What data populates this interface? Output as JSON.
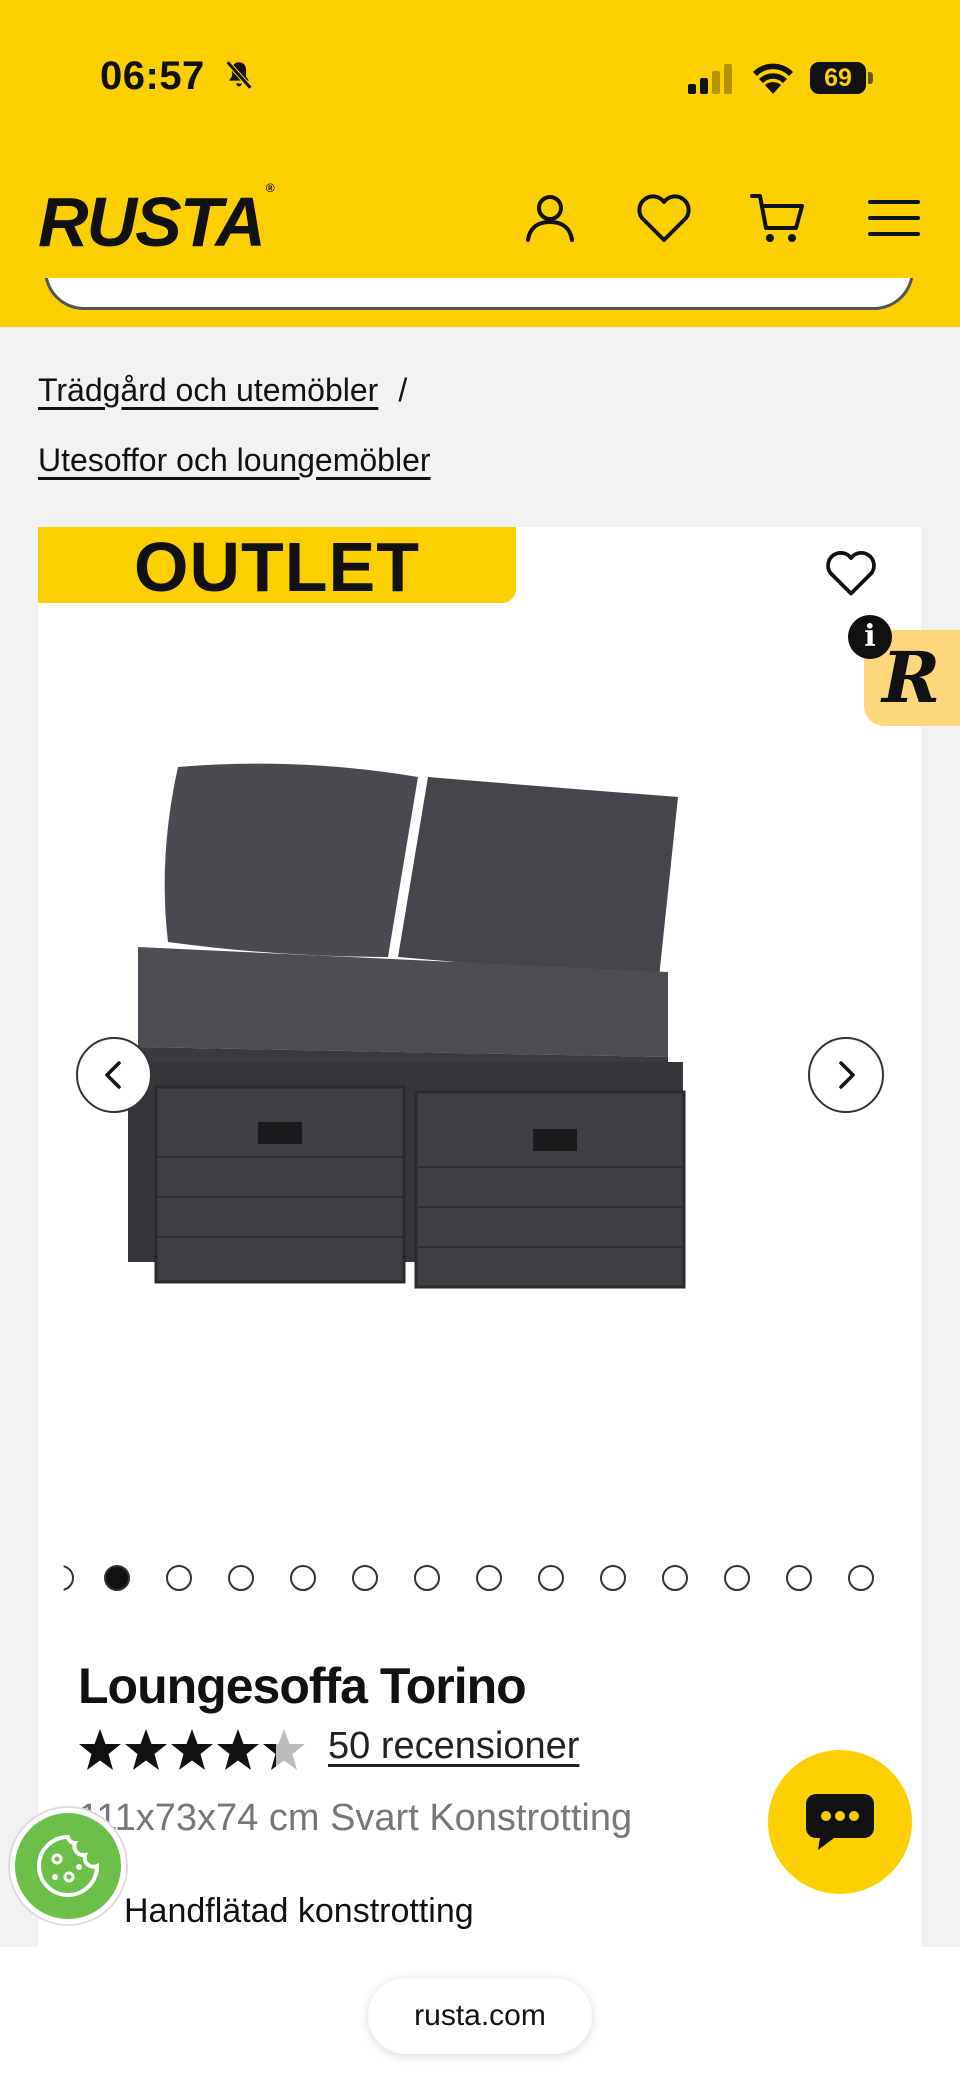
{
  "status_bar": {
    "time": "06:57",
    "battery": "69"
  },
  "header": {
    "logo": "RUSTA",
    "logo_mark": "®"
  },
  "breadcrumb": {
    "items": [
      "Trädgård och utemöbler",
      "Utesoffor och loungemöbler"
    ],
    "separator": "/"
  },
  "product": {
    "badge": "OUTLET",
    "title": "Loungesoffa Torino",
    "rating": 4.7,
    "reviews": "50 recensioner",
    "spec": "111x73x74 cm Svart Konstrotting",
    "feature": "Handflätad konstrotting",
    "gallery": {
      "total": 14,
      "active_index": 1
    }
  },
  "widgets": {
    "info_label": "i",
    "r_label": "R"
  },
  "browser": {
    "url": "rusta.com"
  },
  "colors": {
    "brand": "#fcd000",
    "text": "#111111"
  }
}
